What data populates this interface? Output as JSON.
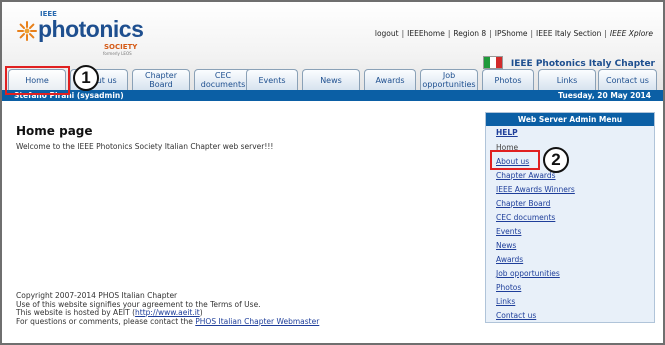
{
  "logo": {
    "ieee": "IEEE",
    "name": "photonics",
    "society": "SOCIETY",
    "formerly": "formerly LEOS"
  },
  "top_links": [
    "logout",
    "IEEEhome",
    "Region 8",
    "IPShome",
    "IEEE Italy Section",
    "IEEE Xplore"
  ],
  "chapter_title": "IEEE Photonics Italy Chapter",
  "flag_colors": [
    "#1f9a3a",
    "#ffffff",
    "#d22a2a"
  ],
  "tabs": [
    "Home",
    "About us",
    "Chapter Board",
    "CEC documents",
    "Events",
    "News",
    "Awards",
    "Job opportunities",
    "Photos",
    "Links",
    "Contact us"
  ],
  "status_bar": {
    "user": "Stefano Pirani (sysadmin)",
    "date": "Tuesday, 20 May 2014"
  },
  "main": {
    "title": "Home page",
    "welcome": "Welcome to the IEEE Photonics Society Italian Chapter web server!!!"
  },
  "footer": {
    "line1": "Copyright 2007-2014 PHOS Italian Chapter",
    "line2": "Use of this website signifies your agreement to the Terms of Use.",
    "line3_prefix": "This website is hosted by AEIT (",
    "line3_link": "http://www.aeit.it",
    "line3_suffix": ")",
    "line4_prefix": "For questions or comments, please contact the ",
    "line4_link": "PHOS Italian Chapter Webmaster"
  },
  "admin_menu": {
    "header": "Web Server Admin Menu",
    "items": [
      "HELP",
      "Home",
      "About us",
      "Chapter Awards",
      "IEEE Awards Winners",
      "Chapter Board",
      "CEC documents",
      "Events",
      "News",
      "Awards",
      "Job opportunities",
      "Photos",
      "Links",
      "Contact us"
    ]
  },
  "annotations": {
    "badge1": "1",
    "badge2": "2"
  },
  "colors": {
    "brand_blue": "#0b5fa5",
    "highlight_red": "#e02020"
  }
}
